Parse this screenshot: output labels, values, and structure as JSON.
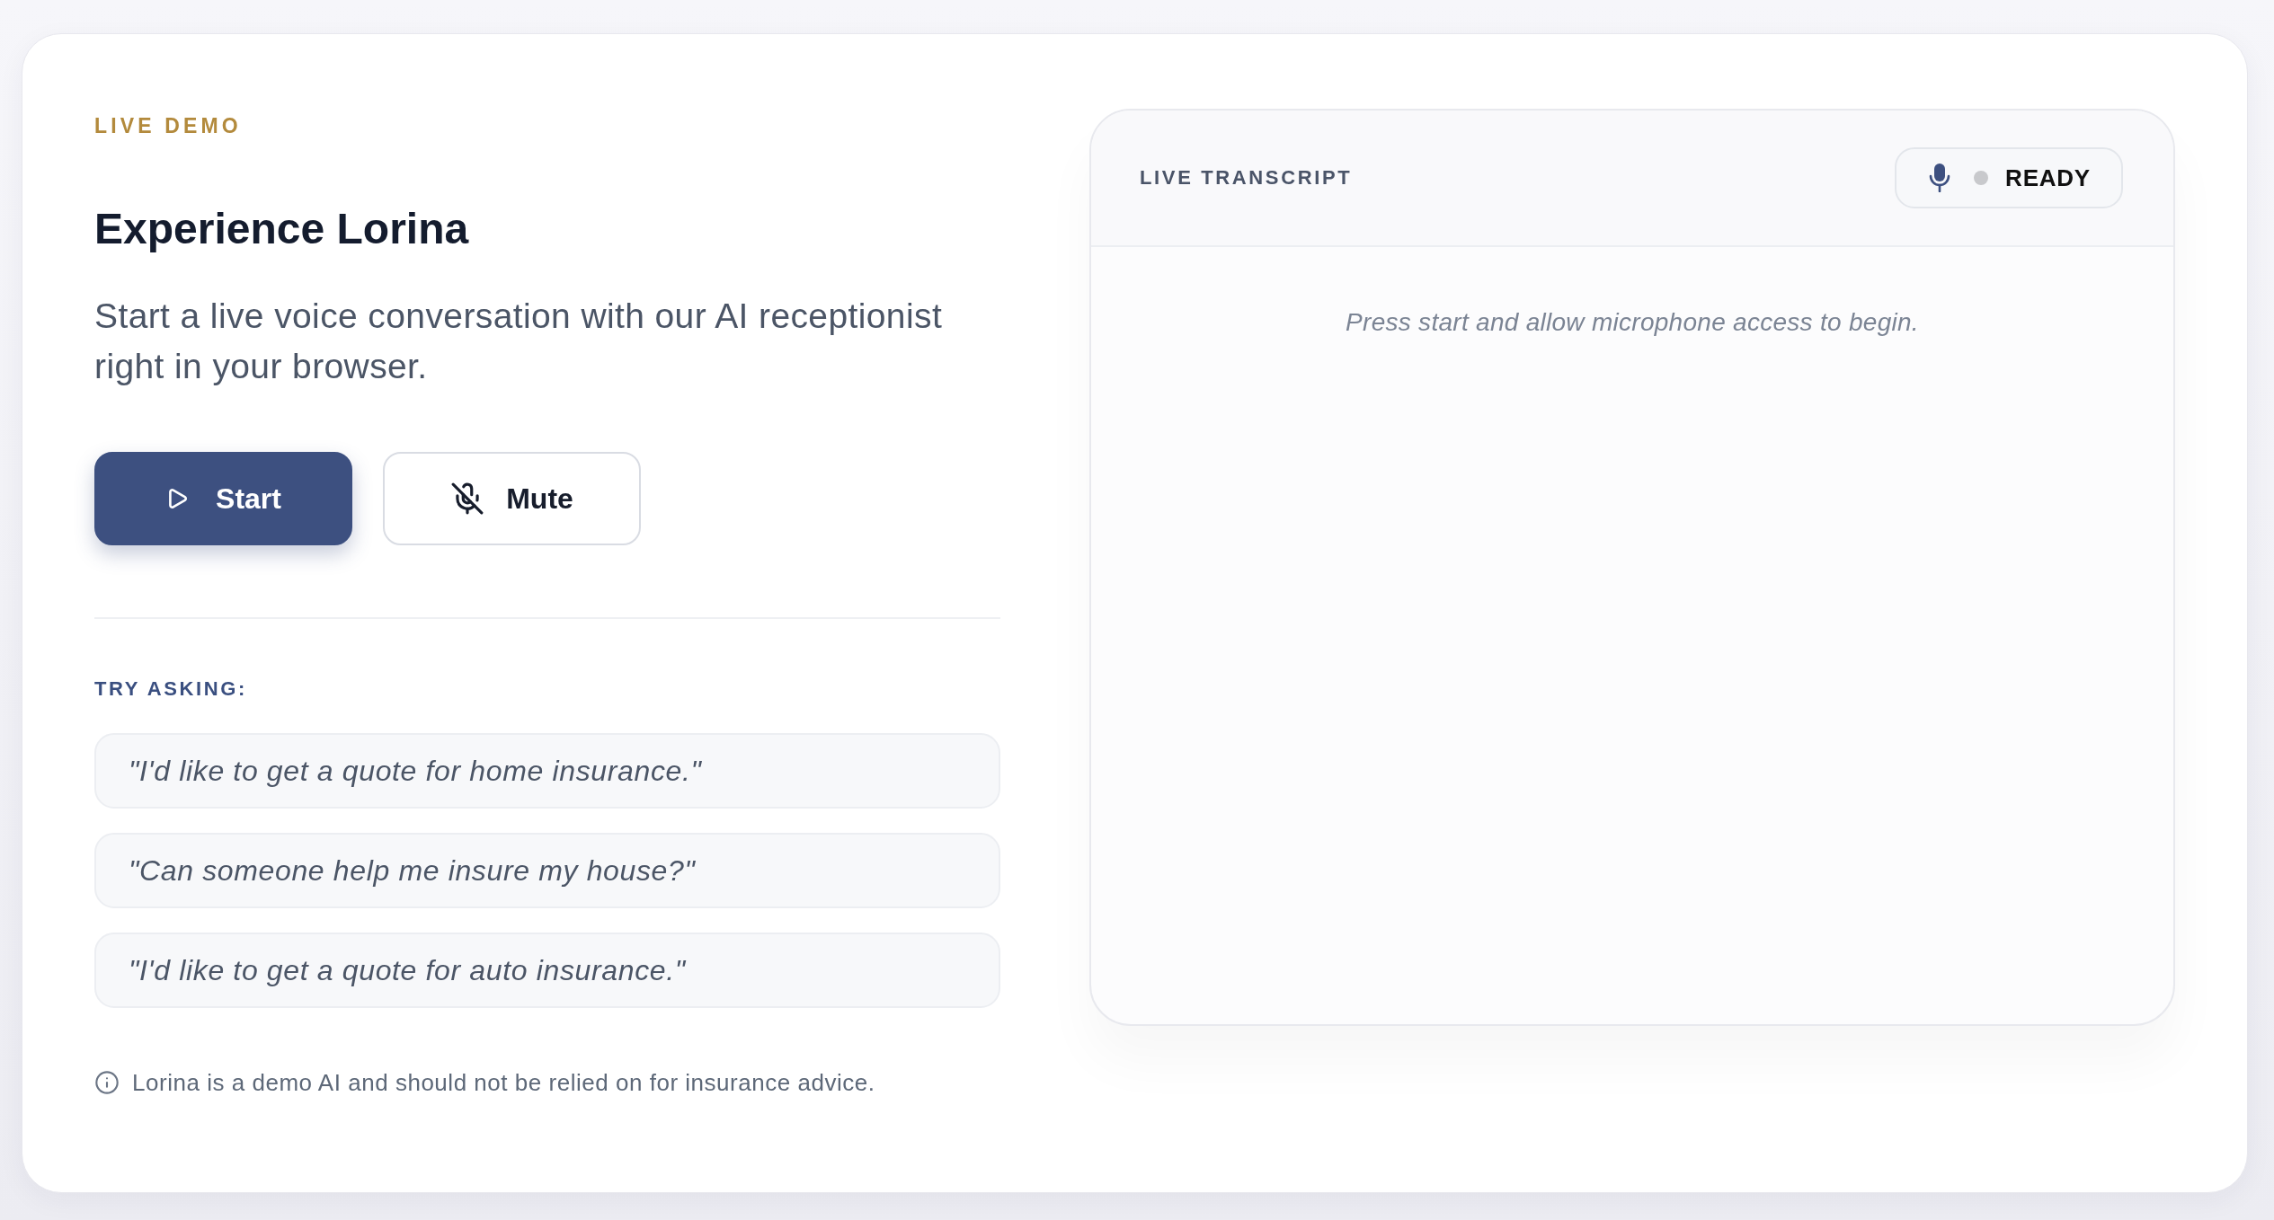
{
  "demo": {
    "eyebrow": "LIVE DEMO",
    "title": "Experience Lorina",
    "description": "Start a live voice conversation with our AI receptionist right in your browser.",
    "buttons": [
      {
        "kind": "start",
        "label": "Start"
      },
      {
        "kind": "mute",
        "label": "Mute"
      }
    ],
    "suggestions": {
      "heading": "TRY ASKING:",
      "items": [
        "\"I'd like to get a quote for home insurance.\"",
        "\"Can someone help me insure my house?\"",
        "\"I'd like to get a quote for auto insurance.\""
      ]
    },
    "disclaimer": "Lorina is a demo AI and should not be relied on for insurance advice."
  },
  "transcript": {
    "title": "LIVE TRANSCRIPT",
    "status": {
      "label": "READY",
      "active": false
    },
    "empty_message": "Press start and allow microphone access to begin."
  }
}
